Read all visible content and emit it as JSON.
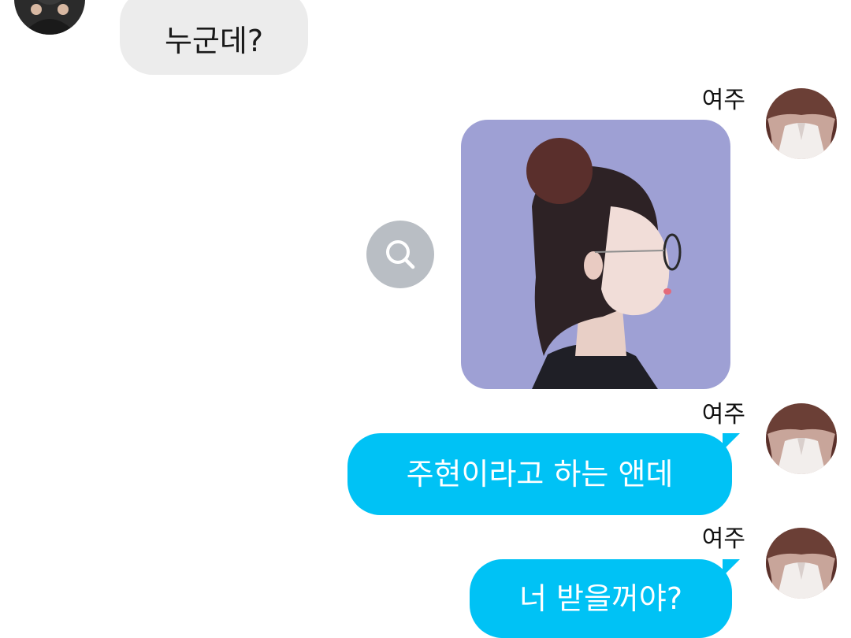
{
  "messages": [
    {
      "sender": "",
      "direction": "incoming",
      "type": "text",
      "text": "누군데?"
    },
    {
      "sender": "여주",
      "direction": "outgoing",
      "type": "image",
      "icon": "portrait-photo"
    },
    {
      "sender": "여주",
      "direction": "outgoing",
      "type": "text",
      "text": "주현이라고 하는 앤데"
    },
    {
      "sender": "여주",
      "direction": "outgoing",
      "type": "text",
      "text": "너 받을꺼야?"
    }
  ],
  "icons": {
    "zoom": "search-icon",
    "other_avatar": "avatar-icon",
    "self_avatar": "avatar-icon"
  },
  "colors": {
    "outgoing_bubble": "#00c2f5",
    "incoming_bubble": "#ececec",
    "zoom_button": "#b9bec4",
    "photo_background": "#9ea0d4"
  }
}
